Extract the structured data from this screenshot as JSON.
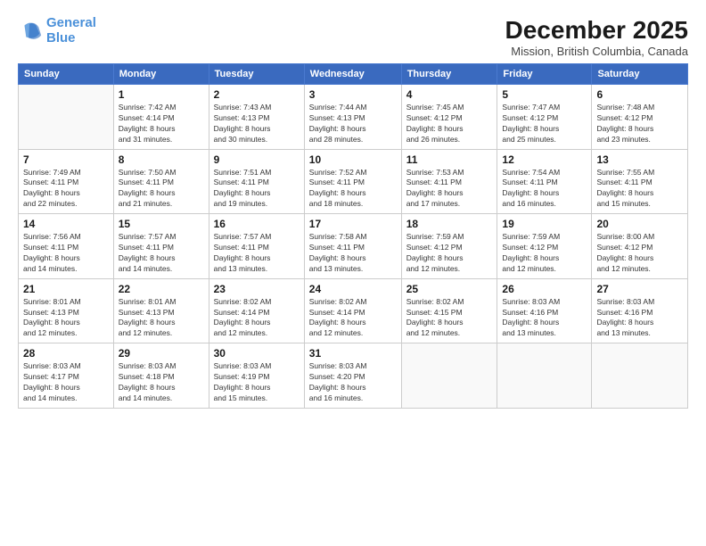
{
  "logo": {
    "line1": "General",
    "line2": "Blue"
  },
  "title": "December 2025",
  "subtitle": "Mission, British Columbia, Canada",
  "days_header": [
    "Sunday",
    "Monday",
    "Tuesday",
    "Wednesday",
    "Thursday",
    "Friday",
    "Saturday"
  ],
  "weeks": [
    [
      {
        "num": "",
        "info": ""
      },
      {
        "num": "1",
        "info": "Sunrise: 7:42 AM\nSunset: 4:14 PM\nDaylight: 8 hours\nand 31 minutes."
      },
      {
        "num": "2",
        "info": "Sunrise: 7:43 AM\nSunset: 4:13 PM\nDaylight: 8 hours\nand 30 minutes."
      },
      {
        "num": "3",
        "info": "Sunrise: 7:44 AM\nSunset: 4:13 PM\nDaylight: 8 hours\nand 28 minutes."
      },
      {
        "num": "4",
        "info": "Sunrise: 7:45 AM\nSunset: 4:12 PM\nDaylight: 8 hours\nand 26 minutes."
      },
      {
        "num": "5",
        "info": "Sunrise: 7:47 AM\nSunset: 4:12 PM\nDaylight: 8 hours\nand 25 minutes."
      },
      {
        "num": "6",
        "info": "Sunrise: 7:48 AM\nSunset: 4:12 PM\nDaylight: 8 hours\nand 23 minutes."
      }
    ],
    [
      {
        "num": "7",
        "info": "Sunrise: 7:49 AM\nSunset: 4:11 PM\nDaylight: 8 hours\nand 22 minutes."
      },
      {
        "num": "8",
        "info": "Sunrise: 7:50 AM\nSunset: 4:11 PM\nDaylight: 8 hours\nand 21 minutes."
      },
      {
        "num": "9",
        "info": "Sunrise: 7:51 AM\nSunset: 4:11 PM\nDaylight: 8 hours\nand 19 minutes."
      },
      {
        "num": "10",
        "info": "Sunrise: 7:52 AM\nSunset: 4:11 PM\nDaylight: 8 hours\nand 18 minutes."
      },
      {
        "num": "11",
        "info": "Sunrise: 7:53 AM\nSunset: 4:11 PM\nDaylight: 8 hours\nand 17 minutes."
      },
      {
        "num": "12",
        "info": "Sunrise: 7:54 AM\nSunset: 4:11 PM\nDaylight: 8 hours\nand 16 minutes."
      },
      {
        "num": "13",
        "info": "Sunrise: 7:55 AM\nSunset: 4:11 PM\nDaylight: 8 hours\nand 15 minutes."
      }
    ],
    [
      {
        "num": "14",
        "info": "Sunrise: 7:56 AM\nSunset: 4:11 PM\nDaylight: 8 hours\nand 14 minutes."
      },
      {
        "num": "15",
        "info": "Sunrise: 7:57 AM\nSunset: 4:11 PM\nDaylight: 8 hours\nand 14 minutes."
      },
      {
        "num": "16",
        "info": "Sunrise: 7:57 AM\nSunset: 4:11 PM\nDaylight: 8 hours\nand 13 minutes."
      },
      {
        "num": "17",
        "info": "Sunrise: 7:58 AM\nSunset: 4:11 PM\nDaylight: 8 hours\nand 13 minutes."
      },
      {
        "num": "18",
        "info": "Sunrise: 7:59 AM\nSunset: 4:12 PM\nDaylight: 8 hours\nand 12 minutes."
      },
      {
        "num": "19",
        "info": "Sunrise: 7:59 AM\nSunset: 4:12 PM\nDaylight: 8 hours\nand 12 minutes."
      },
      {
        "num": "20",
        "info": "Sunrise: 8:00 AM\nSunset: 4:12 PM\nDaylight: 8 hours\nand 12 minutes."
      }
    ],
    [
      {
        "num": "21",
        "info": "Sunrise: 8:01 AM\nSunset: 4:13 PM\nDaylight: 8 hours\nand 12 minutes."
      },
      {
        "num": "22",
        "info": "Sunrise: 8:01 AM\nSunset: 4:13 PM\nDaylight: 8 hours\nand 12 minutes."
      },
      {
        "num": "23",
        "info": "Sunrise: 8:02 AM\nSunset: 4:14 PM\nDaylight: 8 hours\nand 12 minutes."
      },
      {
        "num": "24",
        "info": "Sunrise: 8:02 AM\nSunset: 4:14 PM\nDaylight: 8 hours\nand 12 minutes."
      },
      {
        "num": "25",
        "info": "Sunrise: 8:02 AM\nSunset: 4:15 PM\nDaylight: 8 hours\nand 12 minutes."
      },
      {
        "num": "26",
        "info": "Sunrise: 8:03 AM\nSunset: 4:16 PM\nDaylight: 8 hours\nand 13 minutes."
      },
      {
        "num": "27",
        "info": "Sunrise: 8:03 AM\nSunset: 4:16 PM\nDaylight: 8 hours\nand 13 minutes."
      }
    ],
    [
      {
        "num": "28",
        "info": "Sunrise: 8:03 AM\nSunset: 4:17 PM\nDaylight: 8 hours\nand 14 minutes."
      },
      {
        "num": "29",
        "info": "Sunrise: 8:03 AM\nSunset: 4:18 PM\nDaylight: 8 hours\nand 14 minutes."
      },
      {
        "num": "30",
        "info": "Sunrise: 8:03 AM\nSunset: 4:19 PM\nDaylight: 8 hours\nand 15 minutes."
      },
      {
        "num": "31",
        "info": "Sunrise: 8:03 AM\nSunset: 4:20 PM\nDaylight: 8 hours\nand 16 minutes."
      },
      {
        "num": "",
        "info": ""
      },
      {
        "num": "",
        "info": ""
      },
      {
        "num": "",
        "info": ""
      }
    ]
  ]
}
